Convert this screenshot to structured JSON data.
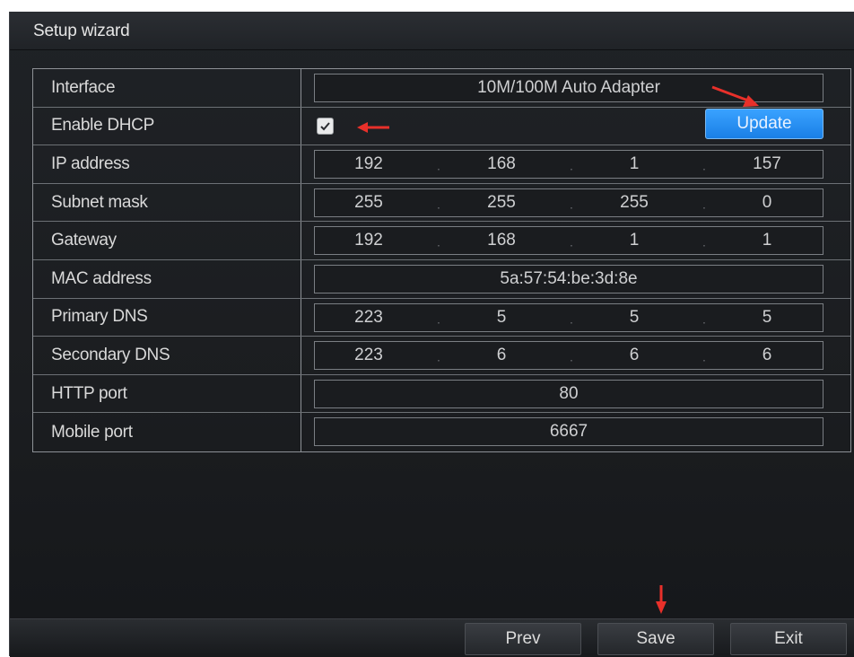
{
  "window": {
    "title": "Setup wizard"
  },
  "rows": {
    "interface": {
      "label": "Interface",
      "value": "10M/100M Auto Adapter"
    },
    "dhcp": {
      "label": "Enable DHCP",
      "checked": true,
      "update_label": "Update"
    },
    "ip": {
      "label": "IP address",
      "octets": [
        "192",
        "168",
        "1",
        "157"
      ]
    },
    "subnet": {
      "label": "Subnet mask",
      "octets": [
        "255",
        "255",
        "255",
        "0"
      ]
    },
    "gateway": {
      "label": "Gateway",
      "octets": [
        "192",
        "168",
        "1",
        "1"
      ]
    },
    "mac": {
      "label": "MAC address",
      "value": "5a:57:54:be:3d:8e"
    },
    "dns1": {
      "label": "Primary DNS",
      "octets": [
        "223",
        "5",
        "5",
        "5"
      ]
    },
    "dns2": {
      "label": "Secondary DNS",
      "octets": [
        "223",
        "6",
        "6",
        "6"
      ]
    },
    "http": {
      "label": "HTTP port",
      "value": "80"
    },
    "mobile": {
      "label": "Mobile port",
      "value": "6667"
    }
  },
  "separator": ".",
  "buttons": {
    "prev": "Prev",
    "save": "Save",
    "exit": "Exit"
  },
  "colors": {
    "accent": "#1a7fe6",
    "annotation": "#e8302a",
    "background": "#1c1e21"
  }
}
